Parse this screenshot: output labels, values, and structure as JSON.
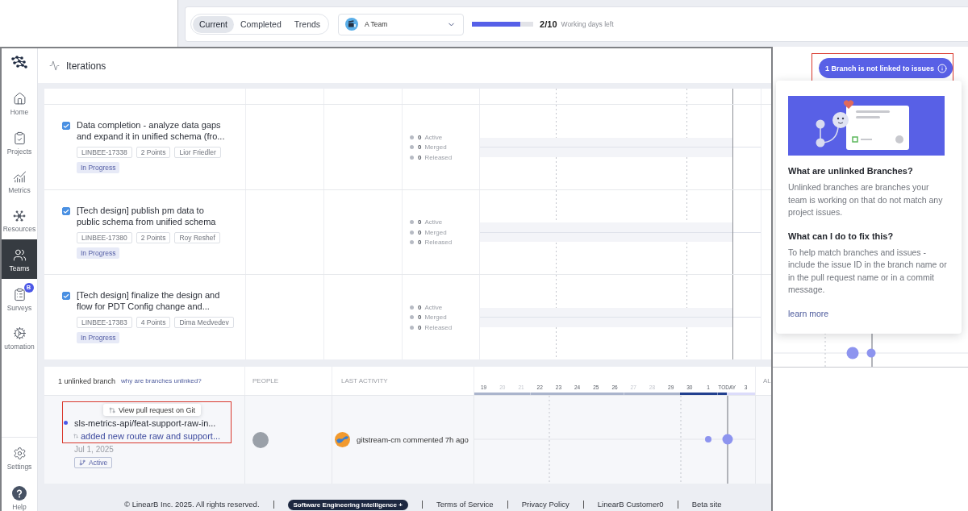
{
  "background_page": {
    "tabs": [
      {
        "label": "Current",
        "selected": true
      },
      {
        "label": "Completed",
        "selected": false
      },
      {
        "label": "Trends",
        "selected": false
      }
    ],
    "team_select": {
      "value": "A Team"
    },
    "sprint_progress": {
      "level": 0.79,
      "count": "2/10",
      "label": "Working days left"
    },
    "unlinked_button": {
      "label": "1 Branch is not linked to issues"
    },
    "popover": {
      "sections": [
        {
          "title": "What are unlinked Branches?",
          "body": "Unlinked branches are branches your team is working on that do not match any project issues."
        },
        {
          "title": "What can I do to fix this?",
          "body": "To help match branches and issues - include the issue ID in the branch name or in the pull request name or in a commit message."
        }
      ],
      "link": "learn more"
    }
  },
  "window": {
    "sidebar": {
      "items": [
        {
          "label": "Home",
          "kind": "home",
          "selected": false
        },
        {
          "label": "Projects",
          "kind": "projects",
          "selected": false
        },
        {
          "label": "Metrics",
          "kind": "metrics",
          "selected": false
        },
        {
          "label": "Resources",
          "kind": "resources",
          "selected": false
        },
        {
          "label": "Teams",
          "kind": "teams",
          "selected": true
        },
        {
          "label": "Surveys",
          "kind": "surveys",
          "selected": false,
          "badge": "B"
        },
        {
          "label": "utomation",
          "kind": "automation",
          "selected": false
        }
      ],
      "bottom_items": [
        {
          "label": "Settings",
          "kind": "settings",
          "selected": false
        },
        {
          "label": "Help",
          "kind": "help",
          "selected": false
        }
      ]
    },
    "header": {
      "title": "Iterations"
    },
    "issues": [
      {
        "checked": true,
        "title": "Data completion - analyze data gaps and expand it in unified schema (fro...",
        "key": "LINBEE-17338",
        "points": "2 Points",
        "assignee": "Lior Friedler",
        "status": "In Progress",
        "branches": [
          {
            "count": "0",
            "label": "Active"
          },
          {
            "count": "0",
            "label": "Merged"
          },
          {
            "count": "0",
            "label": "Released"
          }
        ]
      },
      {
        "checked": true,
        "title": "[Tech design] publish pm data to public schema from unified schema",
        "key": "LINBEE-17380",
        "points": "2 Points",
        "assignee": "Roy Reshef",
        "status": "In Progress",
        "branches": [
          {
            "count": "0",
            "label": "Active"
          },
          {
            "count": "0",
            "label": "Merged"
          },
          {
            "count": "0",
            "label": "Released"
          }
        ]
      },
      {
        "checked": true,
        "title": "[Tech design] finalize the design and flow for PDT Config change and...",
        "key": "LINBEE-17383",
        "points": "4 Points",
        "assignee": "Dima Medvedev",
        "status": "In Progress",
        "branches": [
          {
            "count": "0",
            "label": "Active"
          },
          {
            "count": "0",
            "label": "Merged"
          },
          {
            "count": "0",
            "label": "Released"
          }
        ]
      }
    ],
    "branches": {
      "summary": "1 unlinked branch",
      "help_link": "why are branches unlinked?",
      "columns": [
        "PEOPLE",
        "LAST ACTIVITY"
      ],
      "dates": [
        {
          "label": "19",
          "muted": false,
          "kind": "past"
        },
        {
          "label": "20",
          "muted": true,
          "kind": "past"
        },
        {
          "label": "21",
          "muted": true,
          "kind": "past"
        },
        {
          "label": "22",
          "muted": false,
          "kind": "past"
        },
        {
          "label": "23",
          "muted": false,
          "kind": "past"
        },
        {
          "label": "24",
          "muted": false,
          "kind": "past"
        },
        {
          "label": "25",
          "muted": false,
          "kind": "past"
        },
        {
          "label": "26",
          "muted": false,
          "kind": "past"
        },
        {
          "label": "27",
          "muted": true,
          "kind": "past"
        },
        {
          "label": "28",
          "muted": true,
          "kind": "past"
        },
        {
          "label": "29",
          "muted": false,
          "kind": "past"
        },
        {
          "label": "30",
          "muted": false,
          "kind": "current"
        },
        {
          "label": "1",
          "muted": false,
          "kind": "current"
        },
        {
          "label": "TODAY",
          "muted": false,
          "kind": "today"
        },
        {
          "label": "3",
          "muted": false,
          "kind": "future"
        }
      ],
      "column_5": "AL",
      "rows": [
        {
          "tooltip": "View pull request on Git",
          "name": "sls-metrics-api/feat-support-raw-in...",
          "pull_request": "added new route raw and support...",
          "date": "Jul 1, 2025",
          "status": "Active",
          "activity": "gitstream-cm commented 7h ago"
        }
      ]
    },
    "footer": {
      "copyright": "© LinearB Inc. 2025. All rights reserved.",
      "badge": "Software Engineering Intelligence +",
      "links": [
        "Terms of Service",
        "Privacy Policy",
        "LinearB Customer0",
        "Beta site"
      ]
    }
  }
}
